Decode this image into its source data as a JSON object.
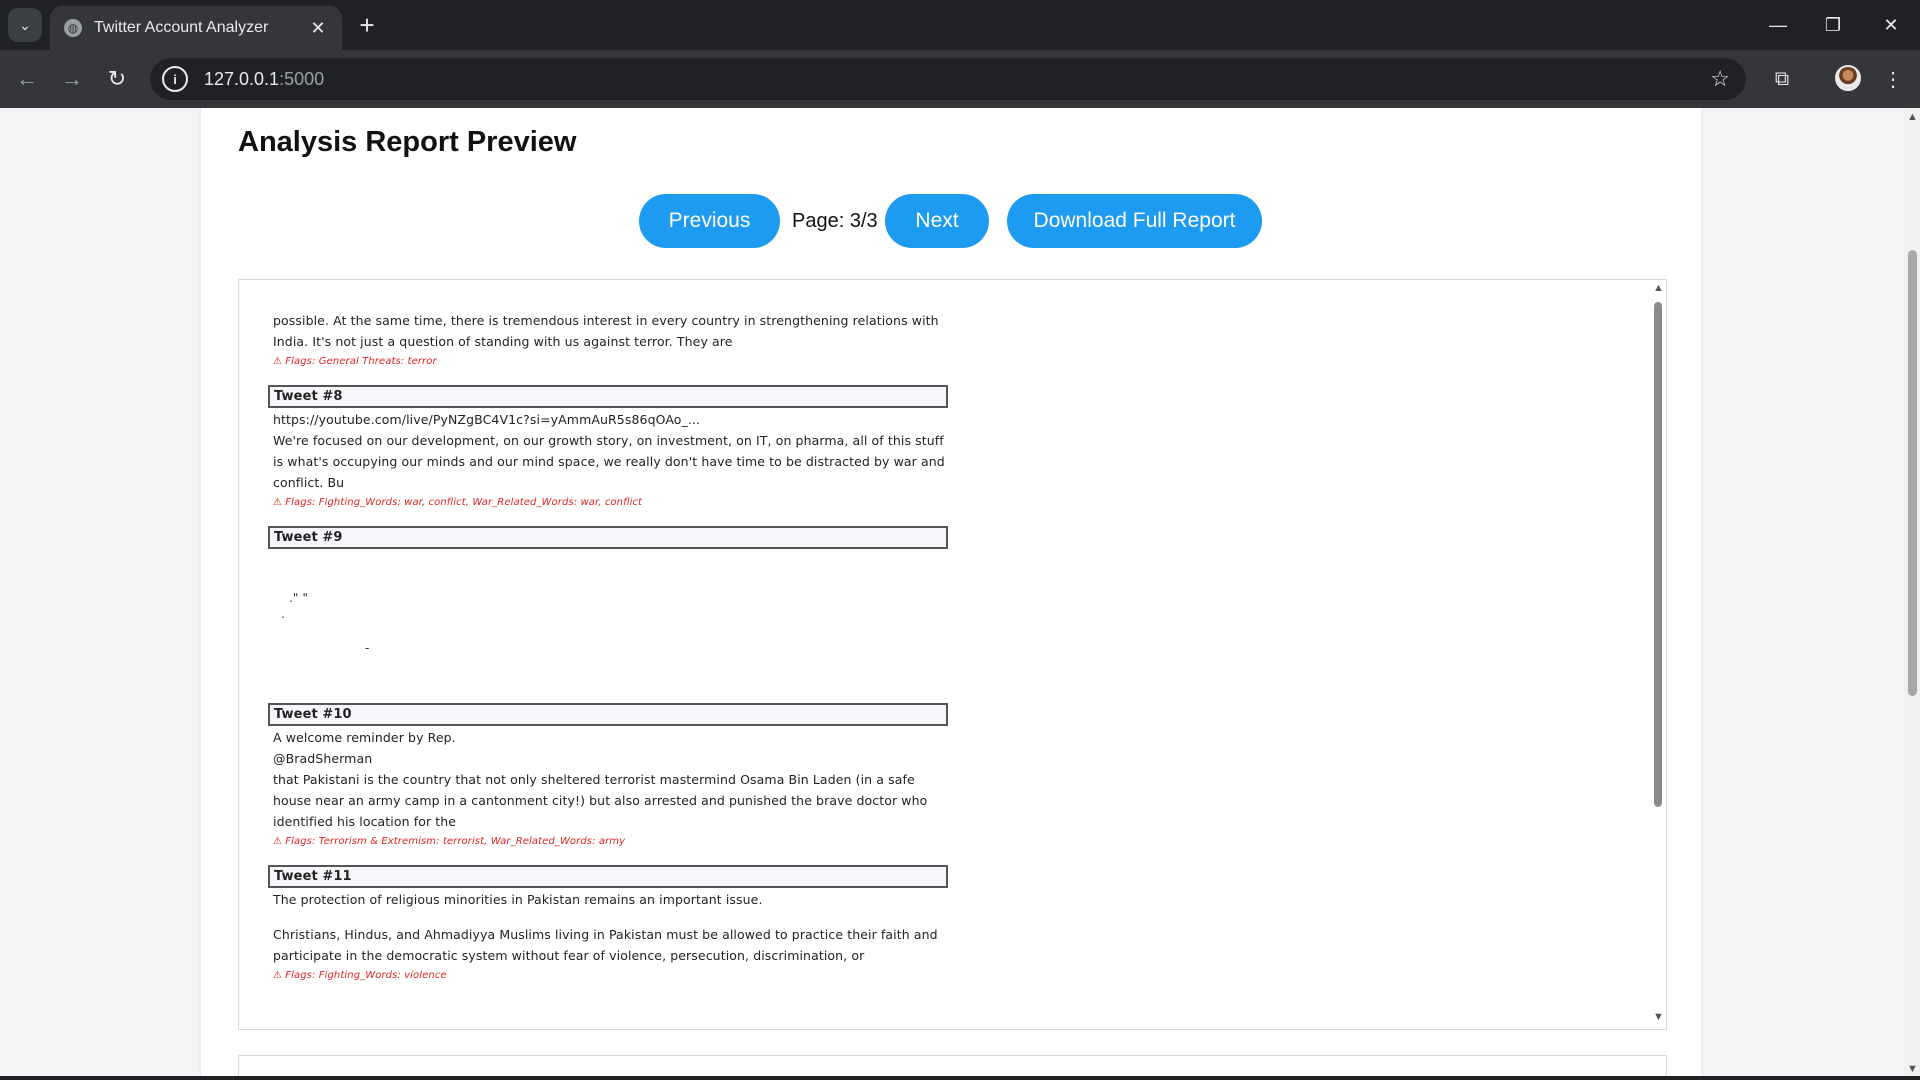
{
  "browser": {
    "tab_title": "Twitter Account Analyzer",
    "tab_close": "✕",
    "new_tab": "+",
    "url_host": "127.0.0.1",
    "url_port": ":5000",
    "icons": [
      "tab-list-icon",
      "globe-icon",
      "close-icon",
      "plus-icon",
      "minimize-icon",
      "restore-icon",
      "window-close-icon",
      "back-icon",
      "forward-icon",
      "reload-icon",
      "info-icon",
      "star-icon",
      "extensions-icon",
      "profile-avatar",
      "menu-icon"
    ]
  },
  "report": {
    "title": "Analysis Report Preview",
    "previous_label": "Previous",
    "page_indicator": "Page: 3/3",
    "next_label": "Next",
    "download_label": "Download Full Report",
    "accent_color": "#1d9bf0",
    "flag_color": "#e02424"
  },
  "doc": {
    "intro_lines": [
      "possible. At the same time, there is tremendous interest in every country in strengthening relations with",
      "India. It's not just a question of standing with us against terror. They are"
    ],
    "intro_flag": "⚠ Flags: General Threats: terror",
    "tweets": [
      {
        "header": "Tweet #8",
        "lines": [
          "https://youtube.com/live/PyNZgBC4V1c?si=yAmmAuR5s86qOAo_...",
          "We're focused on our development, on our growth story, on investment, on IT, on pharma, all of this stuff",
          "is what's occupying our minds and our mind space, we really don't have time to be distracted by war and",
          "conflict. Bu"
        ],
        "flag": "⚠ Flags: Fighting_Words: war, conflict, War_Related_Words: war, conflict"
      },
      {
        "header": "Tweet #9",
        "fragments": [
          ".\" \"",
          ".",
          "-"
        ]
      },
      {
        "header": "Tweet #10",
        "lines": [
          "A welcome reminder by Rep.",
          "@BradSherman",
          " that Pakistani is the country that not only sheltered terrorist mastermind Osama Bin Laden (in a safe",
          "house near an army camp in a cantonment city!) but also arrested and punished the brave doctor who",
          "identified his location for the"
        ],
        "flag": "⚠ Flags: Terrorism & Extremism: terrorist, War_Related_Words: army"
      },
      {
        "header": "Tweet #11",
        "lines": [
          "The protection of religious minorities in Pakistan remains an important issue.",
          "Christians, Hindus, and Ahmadiyya Muslims living in Pakistan must be allowed to practice their faith and",
          "participate in the democratic system without fear of violence, persecution, discrimination, or"
        ],
        "flag": "⚠ Flags: Fighting_Words: violence"
      }
    ]
  }
}
